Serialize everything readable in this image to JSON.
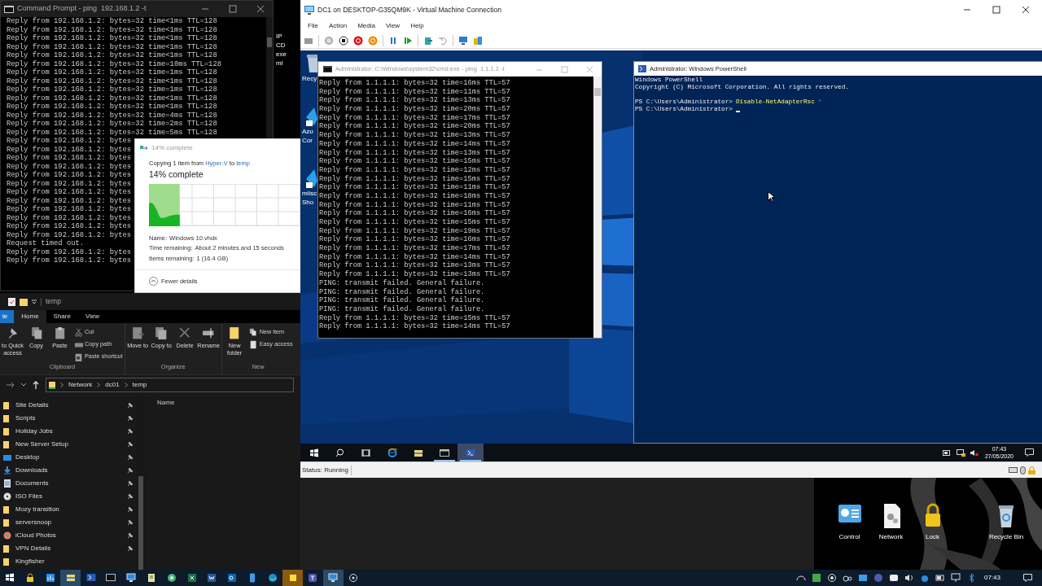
{
  "host_cmd": {
    "title": "Command Prompt - ping  192.168.1.2 -t",
    "lines": [
      "Reply from 192.168.1.2: bytes=32 time<1ms TTL=128",
      "Reply from 192.168.1.2: bytes=32 time<1ms TTL=128",
      "Reply from 192.168.1.2: bytes=32 time<1ms TTL=128",
      "Reply from 192.168.1.2: bytes=32 time<1ms TTL=128",
      "Reply from 192.168.1.2: bytes=32 time<1ms TTL=128",
      "Reply from 192.168.1.2: bytes=32 time=10ms TTL=128",
      "Reply from 192.168.1.2: bytes=32 time=1ms TTL=128",
      "Reply from 192.168.1.2: bytes=32 time<1ms TTL=128",
      "Reply from 192.168.1.2: bytes=32 time=1ms TTL=128",
      "Reply from 192.168.1.2: bytes=32 time<1ms TTL=128",
      "Reply from 192.168.1.2: bytes=32 time<1ms TTL=128",
      "Reply from 192.168.1.2: bytes=32 time=4ms TTL=128",
      "Reply from 192.168.1.2: bytes=32 time=2ms TTL=128",
      "Reply from 192.168.1.2: bytes=32 time=5ms TTL=128",
      "Reply from 192.168.1.2: bytes",
      "Reply from 192.168.1.2: bytes",
      "Reply from 192.168.1.2: bytes",
      "Reply from 192.168.1.2: bytes",
      "Reply from 192.168.1.2: bytes",
      "Reply from 192.168.1.2: bytes",
      "Reply from 192.168.1.2: bytes",
      "Reply from 192.168.1.2: bytes",
      "Reply from 192.168.1.2: bytes",
      "Reply from 192.168.1.2: bytes",
      "Reply from 192.168.1.2: bytes",
      "Reply from 192.168.1.2: bytes",
      "Request timed out.",
      "Reply from 192.168.1.2: bytes",
      "Reply from 192.168.1.2: bytes"
    ]
  },
  "host_desktop_labels": [
    "IP",
    "CD",
    "exe",
    "ml"
  ],
  "copy_dialog": {
    "title": "14% complete",
    "summary_start": "Copying 1 item from ",
    "source": "Hyper-V",
    "summary_middle": " to ",
    "destination": "temp",
    "heading": "14% complete",
    "level": 0.14,
    "details": [
      {
        "label": "Name:",
        "value": "Windows 10.vhdx"
      },
      {
        "label": "Time remaining:",
        "value": "About 2 minutes and 15 seconds"
      },
      {
        "label": "Items remaining:",
        "value": "1 (16.4 GB)"
      }
    ],
    "toggle": "Fewer details"
  },
  "explorer": {
    "title": "temp",
    "tabs": [
      {
        "label": "le",
        "kind": "file",
        "selected": false
      },
      {
        "label": "Home",
        "kind": "tab",
        "selected": true
      },
      {
        "label": "Share",
        "kind": "tab",
        "selected": false
      },
      {
        "label": "View",
        "kind": "tab",
        "selected": false
      }
    ],
    "ribbon": [
      {
        "label": "Clipboard",
        "buttons": [
          {
            "kind": "pin",
            "label": "to Quick access"
          },
          {
            "kind": "copy",
            "label": "Copy"
          },
          {
            "kind": "paste",
            "label": "Paste"
          },
          {
            "kind": "cut",
            "label": "Cut"
          },
          {
            "kind": "copy_path",
            "label": "Copy path"
          },
          {
            "kind": "paste_shortcut",
            "label": "Paste shortcut"
          }
        ]
      },
      {
        "label": "Organize",
        "buttons": [
          {
            "kind": "move",
            "label": "Move to"
          },
          {
            "kind": "copy_to",
            "label": "Copy to"
          },
          {
            "kind": "delete",
            "label": "Delete"
          },
          {
            "kind": "rename",
            "label": "Rename"
          }
        ]
      },
      {
        "label": "New",
        "buttons": [
          {
            "kind": "new_folder",
            "label": "New folder"
          },
          {
            "kind": "new_item",
            "label": "New item"
          },
          {
            "kind": "easy_access",
            "label": "Easy access"
          }
        ]
      }
    ],
    "path": [
      "Network",
      "dc01",
      "temp"
    ],
    "nav": [
      {
        "label": "Site Details",
        "kind": "folder",
        "pinned": true
      },
      {
        "label": "Scripts",
        "kind": "folder",
        "pinned": true
      },
      {
        "label": "Holiday Jobs",
        "kind": "folder",
        "pinned": true
      },
      {
        "label": "New Server Setup",
        "kind": "folder",
        "pinned": true
      },
      {
        "label": "Desktop",
        "kind": "desktop",
        "pinned": true
      },
      {
        "label": "Downloads",
        "kind": "download",
        "pinned": true
      },
      {
        "label": "Documents",
        "kind": "documents",
        "pinned": true
      },
      {
        "label": "ISO Files",
        "kind": "disc",
        "pinned": true
      },
      {
        "label": "Mozy transition",
        "kind": "folder",
        "pinned": true
      },
      {
        "label": "serversnoop",
        "kind": "folder",
        "pinned": true
      },
      {
        "label": "iCloud Photos",
        "kind": "photos",
        "pinned": true
      },
      {
        "label": "VPN Details",
        "kind": "folder",
        "pinned": true
      },
      {
        "label": "Kingfisher",
        "kind": "folder",
        "pinned": false
      }
    ],
    "column": "Name"
  },
  "vm": {
    "title": "DC1 on DESKTOP-G35QM9K - Virtual Machine Connection",
    "menu": [
      "File",
      "Action",
      "Media",
      "View",
      "Help"
    ],
    "status": "Status: Running",
    "guest": {
      "desktop_labels": [
        {
          "kind": "bin",
          "lines": [
            "Recy"
          ]
        },
        {
          "kind": "azure",
          "lines": [
            "Azu",
            "Cor"
          ]
        },
        {
          "kind": "azure",
          "lines": [
            "miisc",
            "Sho"
          ]
        }
      ],
      "cmd": {
        "title": "Administrator: C:\\Windows\\system32\\cmd.exe - ping  1.1.1.1 -t",
        "lines": [
          "Reply from 1.1.1.1: bytes=32 time=16ms TTL=57",
          "Reply from 1.1.1.1: bytes=32 time=11ms TTL=57",
          "Reply from 1.1.1.1: bytes=32 time=13ms TTL=57",
          "Reply from 1.1.1.1: bytes=32 time=20ms TTL=57",
          "Reply from 1.1.1.1: bytes=32 time=17ms TTL=57",
          "Reply from 1.1.1.1: bytes=32 time=20ms TTL=57",
          "Reply from 1.1.1.1: bytes=32 time=13ms TTL=57",
          "Reply from 1.1.1.1: bytes=32 time=14ms TTL=57",
          "Reply from 1.1.1.1: bytes=32 time=13ms TTL=57",
          "Reply from 1.1.1.1: bytes=32 time=15ms TTL=57",
          "Reply from 1.1.1.1: bytes=32 time=12ms TTL=57",
          "Reply from 1.1.1.1: bytes=32 time=15ms TTL=57",
          "Reply from 1.1.1.1: bytes=32 time=11ms TTL=57",
          "Reply from 1.1.1.1: bytes=32 time=18ms TTL=57",
          "Reply from 1.1.1.1: bytes=32 time=11ms TTL=57",
          "Reply from 1.1.1.1: bytes=32 time=16ms TTL=57",
          "Reply from 1.1.1.1: bytes=32 time=15ms TTL=57",
          "Reply from 1.1.1.1: bytes=32 time=19ms TTL=57",
          "Reply from 1.1.1.1: bytes=32 time=16ms TTL=57",
          "Reply from 1.1.1.1: bytes=32 time=17ms TTL=57",
          "Reply from 1.1.1.1: bytes=32 time=14ms TTL=57",
          "Reply from 1.1.1.1: bytes=32 time=13ms TTL=57",
          "Reply from 1.1.1.1: bytes=32 time=13ms TTL=57",
          "PING: transmit failed. General failure.",
          "PING: transmit failed. General failure.",
          "PING: transmit failed. General failure.",
          "PING: transmit failed. General failure.",
          "Reply from 1.1.1.1: bytes=32 time=15ms TTL=57",
          "Reply from 1.1.1.1: bytes=32 time=14ms TTL=57"
        ]
      },
      "powershell": {
        "title": "Administrator: Windows PowerShell",
        "lines": [
          {
            "kind": "output",
            "text": "Windows PowerShell"
          },
          {
            "kind": "output",
            "text": "Copyright (C) Microsoft Corporation. All rights reserved."
          },
          {
            "kind": "prompt",
            "prompt": "PS C:\\Users\\Administrator>",
            "command": "Disable-NetAdapterRsc",
            "argument": "*",
            "cursor": false
          },
          {
            "kind": "prompt",
            "prompt": "PS C:\\Users\\Administrator>",
            "cursor": true
          }
        ]
      },
      "taskbar": {
        "apps": [
          {
            "kind": "start",
            "running": false,
            "selected": false
          },
          {
            "kind": "search",
            "running": false,
            "selected": false
          },
          {
            "kind": "task_view",
            "running": false,
            "selected": false
          },
          {
            "kind": "browser",
            "running": false,
            "selected": false
          },
          {
            "kind": "folder",
            "running": false,
            "selected": false
          },
          {
            "kind": "console",
            "running": true,
            "selected": false
          },
          {
            "kind": "powershell",
            "running": true,
            "selected": true
          }
        ],
        "time": "07:43",
        "date": "27/05/2020"
      }
    }
  },
  "host_desktop_icons": [
    {
      "kind": "control",
      "label": "Control"
    },
    {
      "kind": "network",
      "label": "Network"
    },
    {
      "kind": "lock",
      "label": "Lock"
    },
    {
      "kind": "bin",
      "label": "Recycle Bin"
    }
  ],
  "host_taskbar": {
    "apps": [
      {
        "kind": "start",
        "active": false
      },
      {
        "kind": "lock",
        "active": false
      },
      {
        "kind": "chart",
        "active": false
      },
      {
        "kind": "explorer",
        "active": true
      },
      {
        "kind": "powershell",
        "active": false
      },
      {
        "kind": "console",
        "active": false
      },
      {
        "kind": "monitor",
        "active": false
      },
      {
        "kind": "notepad",
        "active": false
      },
      {
        "kind": "globe",
        "active": false
      },
      {
        "kind": "excel",
        "active": false
      },
      {
        "kind": "word",
        "active": false
      },
      {
        "kind": "outlook",
        "active": false
      },
      {
        "kind": "phone",
        "active": false
      },
      {
        "kind": "edge",
        "active": false
      },
      {
        "kind": "sticky",
        "active": true
      },
      {
        "kind": "teams",
        "active": false
      },
      {
        "kind": "monitor",
        "active": true
      },
      {
        "kind": "circle",
        "active": false
      }
    ],
    "time": "07:43"
  }
}
